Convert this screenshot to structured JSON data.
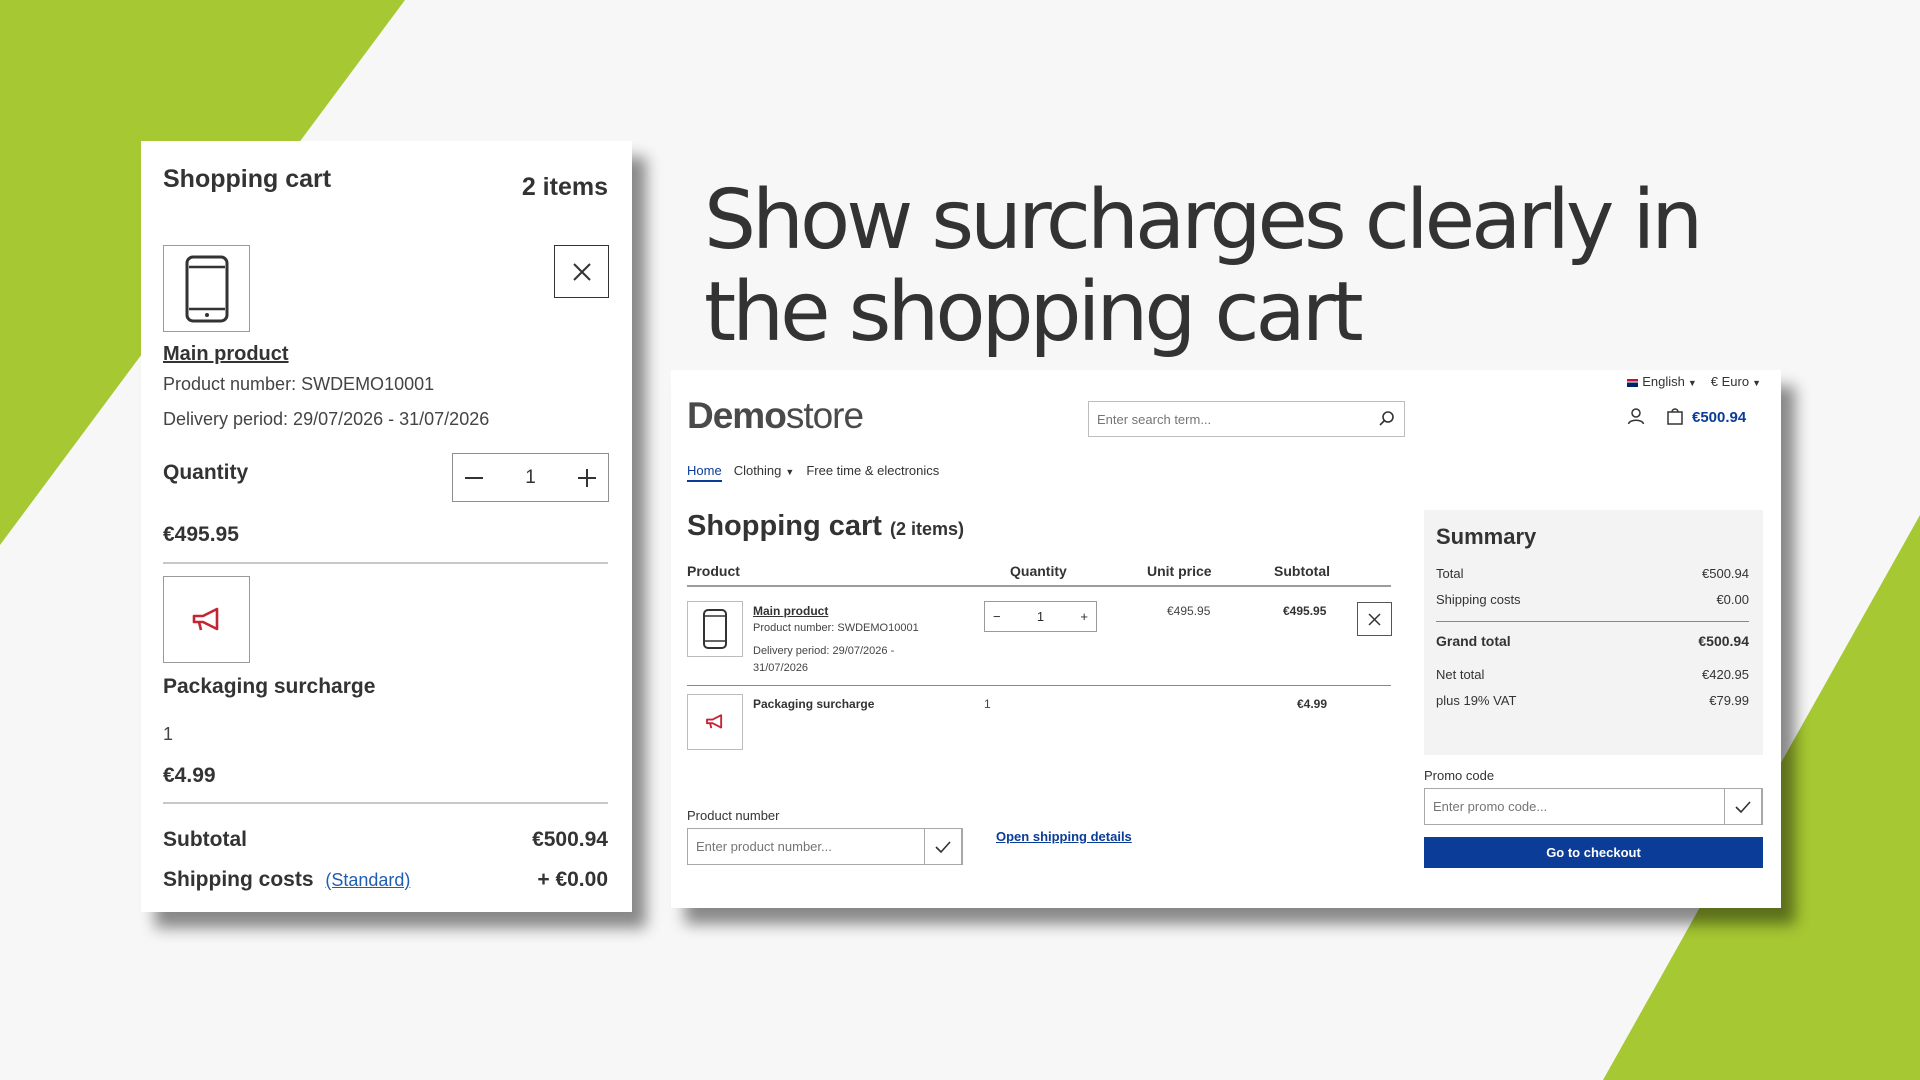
{
  "slide": {
    "headline_line1": "Show surcharges clearly in",
    "headline_line2": "the shopping cart",
    "colors": {
      "accent_green": "#a6c832",
      "background": "#f7f7f7",
      "brand_blue": "#0b3c98",
      "surcharge_icon_red": "#c42434"
    }
  },
  "mobile_cart": {
    "title": "Shopping cart",
    "item_count": "2 items",
    "product": {
      "icon": "smartphone-icon",
      "name": "Main product",
      "number": "Product number: SWDEMO10001",
      "delivery": "Delivery period: 29/07/2026 - 31/07/2026",
      "quantity_label": "Quantity",
      "quantity": "1",
      "price": "€495.95"
    },
    "surcharge": {
      "icon": "megaphone-icon",
      "name": "Packaging surcharge",
      "quantity": "1",
      "price": "€4.99"
    },
    "subtotal_label": "Subtotal",
    "subtotal_value": "€500.94",
    "shipping_label": "Shipping costs",
    "shipping_method": "(Standard)",
    "shipping_value": "+ €0.00"
  },
  "desktop": {
    "topbar": {
      "language": "English",
      "currency": "€ Euro"
    },
    "logo_bold": "Demo",
    "logo_light": "store",
    "search_placeholder": "Enter search term...",
    "cart_total": "€500.94",
    "nav": {
      "home": "Home",
      "clothing": "Clothing",
      "free_time": "Free time & electronics"
    },
    "page_title": "Shopping cart",
    "page_title_count": "(2 items)",
    "table_headers": {
      "product": "Product",
      "quantity": "Quantity",
      "unit_price": "Unit price",
      "subtotal": "Subtotal"
    },
    "line_items": [
      {
        "name": "Main product",
        "number": "Product number: SWDEMO10001",
        "delivery_line1": "Delivery period: 29/07/2026 -",
        "delivery_line2": "31/07/2026",
        "quantity": "1",
        "unit_price": "€495.95",
        "subtotal": "€495.95"
      },
      {
        "name": "Packaging surcharge",
        "quantity": "1",
        "subtotal": "€4.99"
      }
    ],
    "product_number_label": "Product number",
    "product_number_placeholder": "Enter product number...",
    "shipping_details_link": "Open shipping details",
    "summary": {
      "title": "Summary",
      "total_label": "Total",
      "total_value": "€500.94",
      "shipping_label": "Shipping costs",
      "shipping_value": "€0.00",
      "grand_total_label": "Grand total",
      "grand_total_value": "€500.94",
      "net_total_label": "Net total",
      "net_total_value": "€420.95",
      "vat_label": "plus 19% VAT",
      "vat_value": "€79.99"
    },
    "promo_label": "Promo code",
    "promo_placeholder": "Enter promo code...",
    "checkout_button": "Go to checkout"
  }
}
